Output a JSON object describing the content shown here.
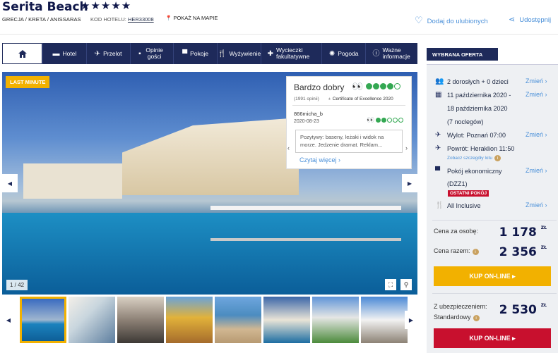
{
  "hotel": {
    "name": "Serita Beach",
    "stars": "★★★★★",
    "location": "GRECJA / KRETA / ANISSARAS",
    "code_label": "KOD HOTELU:",
    "code_value": "HER33008",
    "map_link": "POKAŻ NA MAPIE",
    "favorite": "Dodaj do ulubionych",
    "share": "Udostępnij"
  },
  "nav": {
    "items": [
      {
        "label": "Hotel",
        "icon": "bed-icon"
      },
      {
        "label": "Przelot",
        "icon": "plane-icon"
      },
      {
        "label": "Opinie gości",
        "icon": "chat-icon"
      },
      {
        "label": "Pokoje",
        "icon": "sofa-icon"
      },
      {
        "label": "Wyżywienie",
        "icon": "cutlery-icon"
      },
      {
        "label": "Wycieczki fakultatywne",
        "icon": "signpost-icon"
      },
      {
        "label": "Pogoda",
        "icon": "sun-icon"
      },
      {
        "label": "Ważne informacje",
        "icon": "info-icon"
      }
    ]
  },
  "gallery": {
    "badge": "LAST MINUTE",
    "counter": "1 / 42",
    "current_index": 1,
    "total": 42
  },
  "tripadvisor": {
    "heading": "Bardzo dobry",
    "rating_filled": 4,
    "rating_total": 5,
    "opinions": "(1991 opinii)",
    "certificate": "Certificate of Excellence 2020",
    "review_user": "866micha_b",
    "review_date": "2020-08-23",
    "review_rating_filled": 2,
    "review_text": "Pozytywy: baseny, leżaki i widok na morze. Jedzenie dramat. Reklam...",
    "read_more": "Czytaj więcej"
  },
  "offer": {
    "tag": "WYBRANA OFERTA",
    "guests": "2 dorosłych + 0 dzieci",
    "date_line1": "11 października 2020 -",
    "date_line2": "18 października 2020",
    "date_line3": "(7 noclegów)",
    "departure": "Wylot: Poznań 07:00",
    "return": "Powrót: Heraklion 11:50",
    "flight_details": "Zobacz szczegóły lotu",
    "room_line1": "Pokój ekonomiczny",
    "room_line2": "(DZZ1)",
    "last_rooms": "OSTATNI POKÓJ",
    "board": "All Inclusive",
    "change": "Zmień",
    "price_person_label": "Cena za osobę:",
    "price_person": "1 178",
    "price_total_label": "Cena razem:",
    "price_total": "2 356",
    "currency": "ZŁ",
    "buy": "KUP ON-LINE",
    "insurance_label1": "Z ubezpieczeniem:",
    "insurance_label2": "Standardowy",
    "price_insured": "2 530",
    "buy2": "KUP ON-LINE"
  },
  "colors": {
    "navy": "#1e2a5a",
    "yellow": "#f2b100",
    "red": "#c8102e",
    "link": "#4a90d9"
  }
}
